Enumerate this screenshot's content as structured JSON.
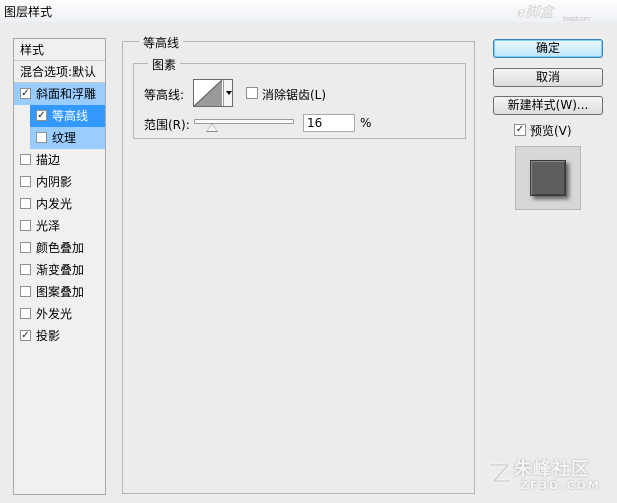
{
  "window": {
    "title": "图层样式"
  },
  "watermarks": {
    "top_main": "e脚盒",
    "top_sub": "lnxsd.com",
    "bottom_main": "朱峰社区",
    "bottom_url": "ZF3D.COM"
  },
  "sidebar": {
    "header": "样式",
    "blending": "混合选项:默认",
    "items": [
      {
        "label": "斜面和浮雕",
        "checked": true,
        "state": "selected-light"
      },
      {
        "label": "等高线",
        "checked": true,
        "state": "selected",
        "sub": true
      },
      {
        "label": "纹理",
        "checked": false,
        "state": "selected-light",
        "sub": true
      },
      {
        "label": "描边",
        "checked": false
      },
      {
        "label": "内阴影",
        "checked": false
      },
      {
        "label": "内发光",
        "checked": false
      },
      {
        "label": "光泽",
        "checked": false
      },
      {
        "label": "颜色叠加",
        "checked": false
      },
      {
        "label": "渐变叠加",
        "checked": false
      },
      {
        "label": "图案叠加",
        "checked": false
      },
      {
        "label": "外发光",
        "checked": false
      },
      {
        "label": "投影",
        "checked": true
      }
    ]
  },
  "panel": {
    "group_title": "等高线",
    "subgroup_title": "图素",
    "contour_label": "等高线:",
    "antialias_label": "消除锯齿(L)",
    "antialias_checked": false,
    "range_label": "范围(R):",
    "range_value": "16",
    "range_unit": "%",
    "range_slider_fraction": 0.16
  },
  "buttons": {
    "ok": "确定",
    "cancel": "取消",
    "new_style": "新建样式(W)...",
    "preview_label": "预览(V)",
    "preview_checked": true
  },
  "colors": {
    "selection": "#3399ff",
    "selection_light": "#99ccff",
    "preview_swatch": "#5e5e5e"
  }
}
